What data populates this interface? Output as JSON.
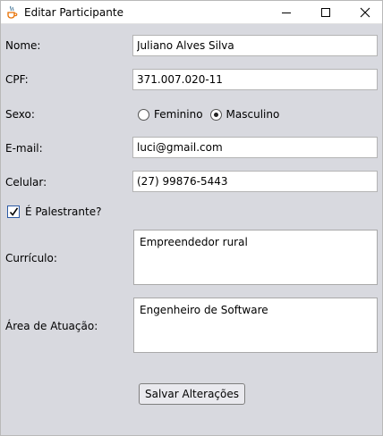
{
  "window": {
    "title": "Editar Participante",
    "app_icon": "java-cup-icon",
    "controls": [
      "minimize-icon",
      "maximize-icon",
      "close-icon"
    ]
  },
  "form": {
    "nome_label": "Nome:",
    "nome_value": "Juliano Alves Silva",
    "cpf_label": "CPF:",
    "cpf_value": "371.007.020-11",
    "sexo_label": "Sexo:",
    "sexo_options": [
      "Feminino",
      "Masculino"
    ],
    "sexo_selected": "Masculino",
    "email_label": "E-mail:",
    "email_value": "luci@gmail.com",
    "celular_label": "Celular:",
    "celular_value": "(27) 99876-5443",
    "palestrante_label": "É Palestrante?",
    "palestrante_checked": true,
    "curriculo_label": "Currículo:",
    "curriculo_value": "Empreendedor rural",
    "area_label": "Área de Atuação:",
    "area_value": "Engenheiro de Software",
    "save_label": "Salvar Alterações"
  },
  "colors": {
    "panel_bg": "#d8d9df",
    "checkbox_accent": "#2b5aa4"
  }
}
